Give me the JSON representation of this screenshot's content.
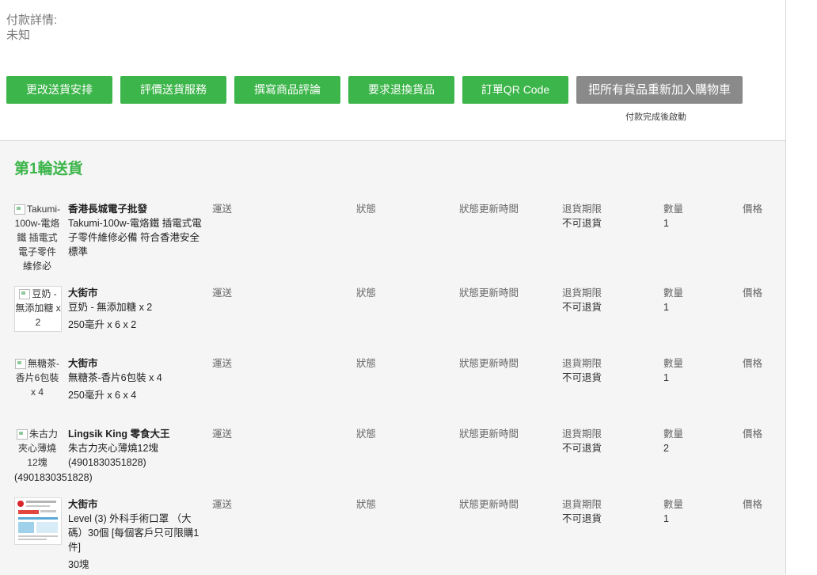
{
  "payment": {
    "label": "付款詳情:",
    "value": "未知"
  },
  "actions": {
    "buttons": [
      {
        "label": "更改送貨安排"
      },
      {
        "label": "評價送貨服務"
      },
      {
        "label": "撰寫商品評論"
      },
      {
        "label": "要求退換貨品"
      },
      {
        "label": "訂單QR Code"
      },
      {
        "label": "把所有貨品重新加入購物車"
      }
    ],
    "note": "付款完成後啟動"
  },
  "delivery": {
    "title": "第1輪送貨",
    "columns": {
      "shipping": "運送",
      "status": "狀態",
      "status_time": "狀態更新時間",
      "return_deadline": "退貨期限",
      "quantity": "數量",
      "price": "價格"
    },
    "items": [
      {
        "img_alt": "Takumi-100w-電烙鐵 插電式 電子零件維修必",
        "shop": "香港長城電子批發",
        "name": "Takumi-100w-電烙鐵 插電式電子零件維修必備 符合香港安全標準",
        "detail": "",
        "return_value": "不可退貨",
        "quantity": "1"
      },
      {
        "img_alt": "豆奶 - 無添加糖 x 2",
        "shop": "大街市",
        "name": "豆奶 - 無添加糖 x 2",
        "detail": "250毫升 x 6 x 2",
        "return_value": "不可退貨",
        "quantity": "1"
      },
      {
        "img_alt": "無糖茶-香片6包裝 x 4",
        "shop": "大街市",
        "name": "無糖茶-香片6包裝 x 4",
        "detail": "250毫升 x 6 x 4",
        "return_value": "不可退貨",
        "quantity": "1"
      },
      {
        "img_alt": "朱古力夾心薄燒12塊",
        "img_alt_extra": "(4901830351828)",
        "shop": "Lingsik King 零食大王",
        "name": "朱古力夾心薄燒12塊 (4901830351828)",
        "detail": "",
        "return_value": "不可退貨",
        "quantity": "2"
      },
      {
        "shop": "大街市",
        "name": "Level (3) 外科手術口罩 （大碼）30個 [每個客戶只可限購1件]",
        "detail": "30塊",
        "return_value": "不可退貨",
        "quantity": "1"
      }
    ]
  },
  "colors": {
    "accent": "#3cb54a",
    "grey_button": "#8a8a8a",
    "panel_bg": "#f5f5f5"
  }
}
